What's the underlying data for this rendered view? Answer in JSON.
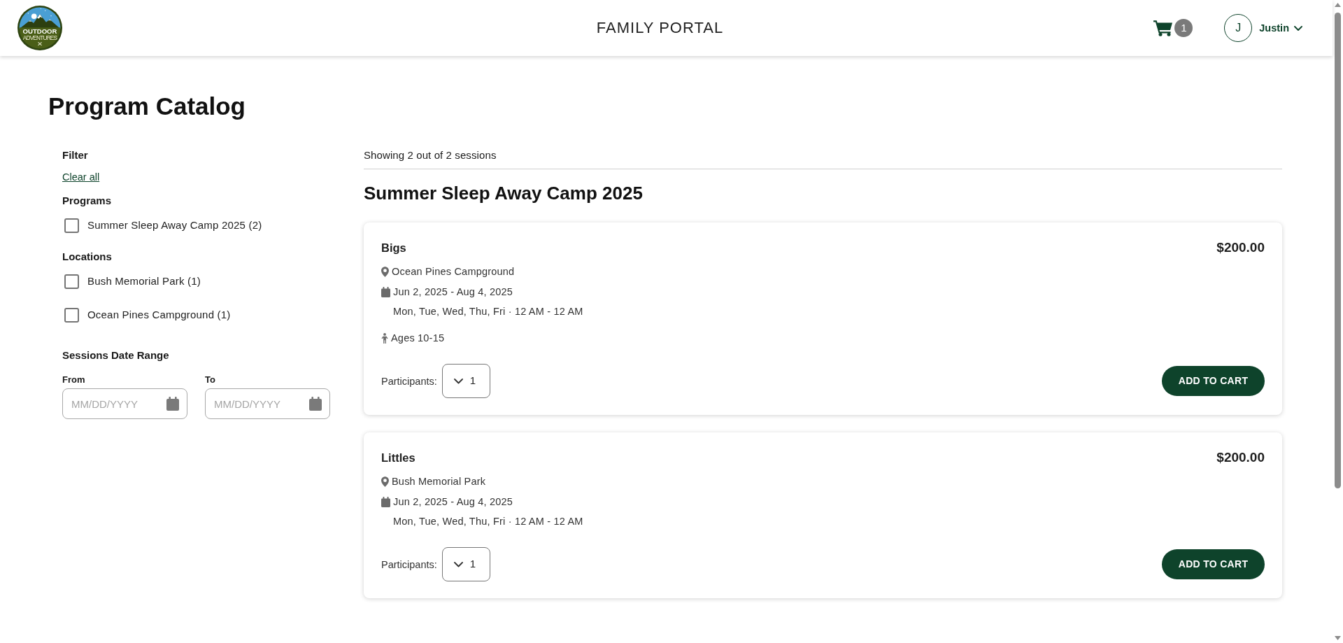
{
  "header": {
    "logo": {
      "wordmark": "OUTDOOR",
      "tagline": "ADVENTURES"
    },
    "title": "FAMILY PORTAL",
    "cart": {
      "count": "1"
    },
    "user": {
      "initial": "J",
      "name": "Justin"
    }
  },
  "page": {
    "title": "Program Catalog"
  },
  "filter": {
    "title": "Filter",
    "clear_link": "Clear all",
    "groups": [
      {
        "title": "Programs",
        "options": [
          {
            "label": "Summer Sleep Away Camp 2025 (2)",
            "checked": false
          }
        ]
      },
      {
        "title": "Locations",
        "options": [
          {
            "label": "Bush Memorial Park (1)",
            "checked": false
          },
          {
            "label": "Ocean Pines Campground (1)",
            "checked": false
          }
        ]
      }
    ],
    "date_range": {
      "title": "Sessions Date Range",
      "fields": [
        {
          "label": "From",
          "placeholder": "MM/DD/YYYY"
        },
        {
          "label": "To",
          "placeholder": "MM/DD/YYYY"
        }
      ]
    }
  },
  "results": {
    "summary": "Showing 2 out of 2 sessions",
    "program_title": "Summer Sleep Away Camp 2025",
    "sessions": [
      {
        "name": "Bigs",
        "price": "$200.00",
        "location": "Ocean Pines Campground",
        "dates": "Jun 2, 2025 - Aug 4, 2025",
        "schedule": "Mon, Tue, Wed, Thu, Fri · 12 AM - 12 AM",
        "ages": "Ages 10-15",
        "participants_label": "Participants:",
        "participants_value": "1",
        "button": "ADD TO CART"
      },
      {
        "name": "Littles",
        "price": "$200.00",
        "location": "Bush Memorial Park",
        "dates": "Jun 2, 2025 - Aug 4, 2025",
        "schedule": "Mon, Tue, Wed, Thu, Fri · 12 AM - 12 AM",
        "participants_label": "Participants:",
        "participants_value": "1",
        "button": "ADD TO CART"
      }
    ]
  }
}
